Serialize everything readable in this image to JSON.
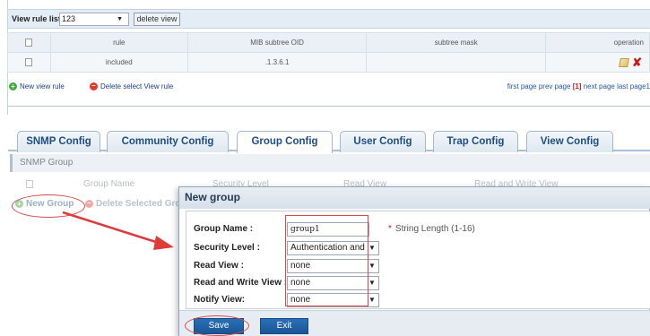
{
  "view_rule": {
    "title": "View rule list",
    "selected_view": "123",
    "delete_label": "delete view",
    "columns": [
      "rule",
      "MIB subtree OID",
      "subtree mask",
      "operation"
    ],
    "rows": [
      {
        "rule": "included",
        "oid": ".1.3.6.1",
        "mask": ""
      }
    ],
    "new_rule_label": "New view rule",
    "delete_rule_label": "Delete select View rule",
    "pager": {
      "first": "first page",
      "prev": "prev page",
      "current": "[1]",
      "next": "next page",
      "last": "last page",
      "trailing": "1"
    }
  },
  "tabs": [
    {
      "label": "SNMP Config",
      "active": false
    },
    {
      "label": "Community Config",
      "active": false
    },
    {
      "label": "Group Config",
      "active": true
    },
    {
      "label": "User Config",
      "active": false
    },
    {
      "label": "Trap Config",
      "active": false
    },
    {
      "label": "View Config",
      "active": false
    }
  ],
  "snmp_group": {
    "title": "SNMP Group",
    "columns": [
      "Group Name",
      "Security Level",
      "Read View",
      "Read and Write View"
    ],
    "new_group_label": "New Group",
    "delete_label": "Delete Selected Gro"
  },
  "dialog": {
    "title": "New group",
    "fields": {
      "group_name_label": "Group Name :",
      "group_name_value": "group1",
      "group_name_hint": "String Length (1-16)",
      "hint_star": "*",
      "security_level_label": "Security Level :",
      "security_level_value": "Authentication and r",
      "read_view_label": "Read View :",
      "read_view_value": "none",
      "rw_view_label": "Read and Write View :",
      "rw_view_value": "none",
      "notify_view_label": "Notify View:",
      "notify_view_value": "none"
    },
    "save_label": "Save",
    "exit_label": "Exit"
  },
  "colors": {
    "accent_blue": "#1d4d86",
    "button_blue": "#1a5596",
    "annotation_red": "#d84a4a",
    "delete_red": "#d01818",
    "add_green": "#3fae36"
  }
}
